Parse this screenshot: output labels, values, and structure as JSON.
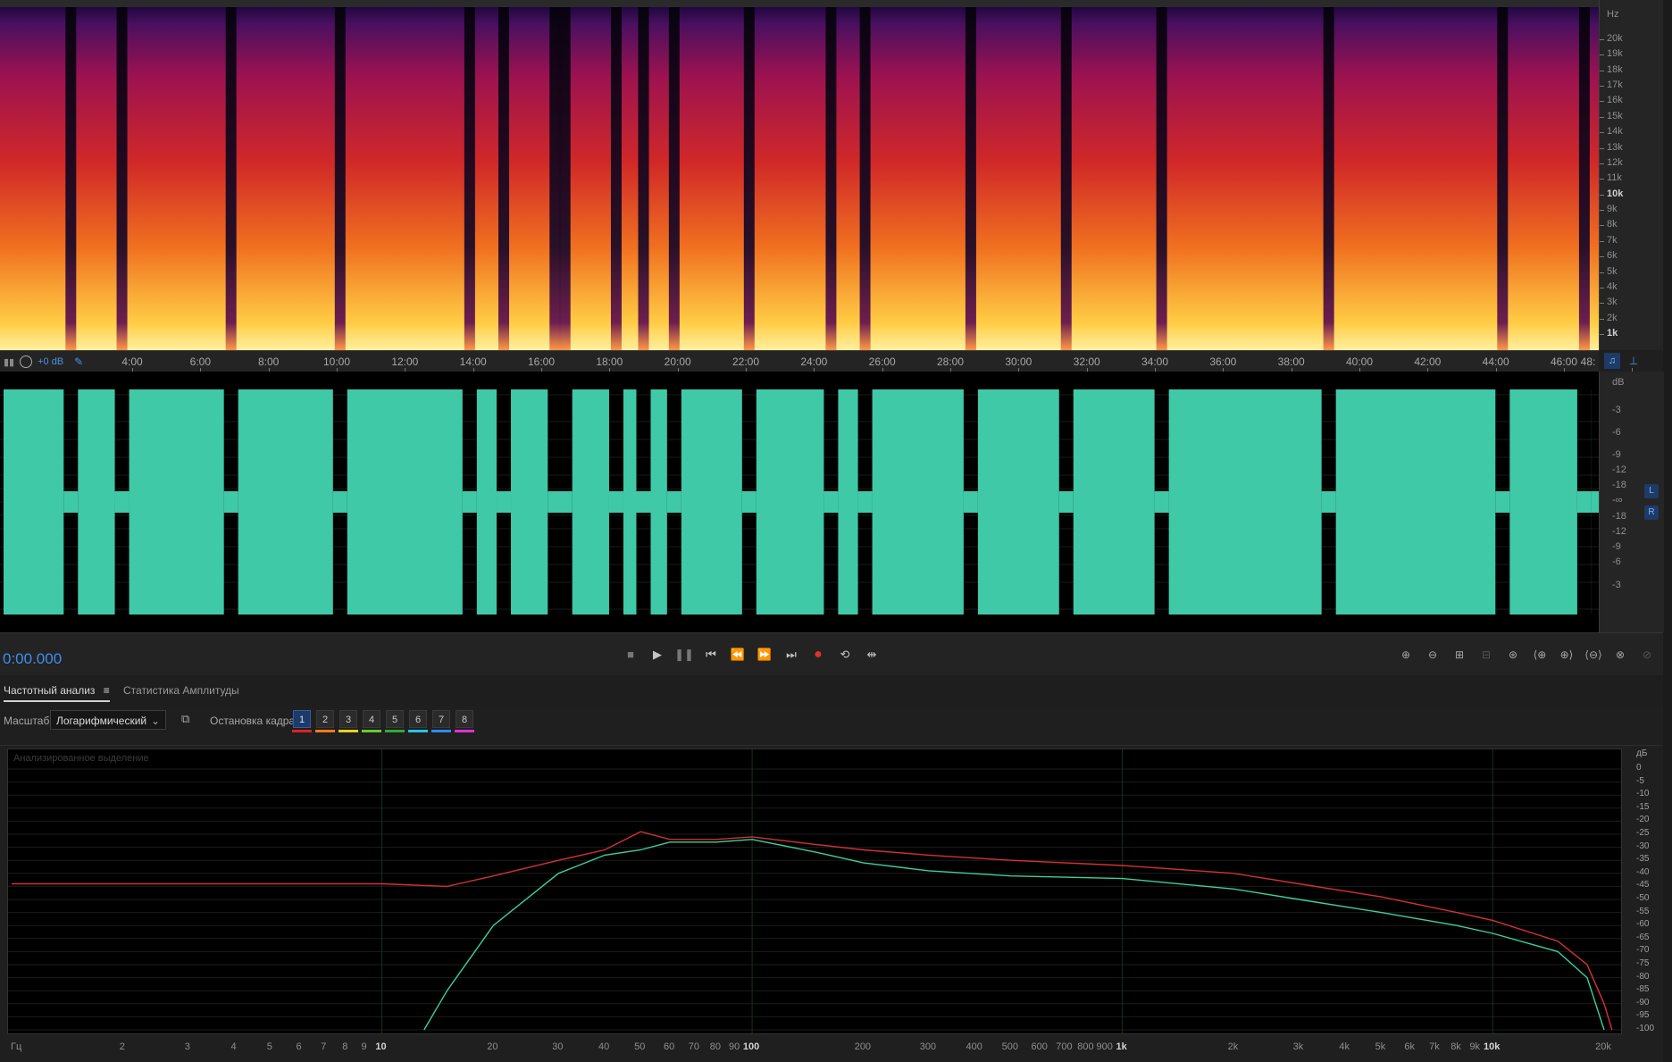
{
  "spectrogram": {
    "unit": "Hz",
    "freq_labels": [
      {
        "text": "20k",
        "v": 20
      },
      {
        "text": "19k",
        "v": 19
      },
      {
        "text": "18k",
        "v": 18
      },
      {
        "text": "17k",
        "v": 17
      },
      {
        "text": "16k",
        "v": 16
      },
      {
        "text": "15k",
        "v": 15
      },
      {
        "text": "14k",
        "v": 14
      },
      {
        "text": "13k",
        "v": 13
      },
      {
        "text": "12k",
        "v": 12
      },
      {
        "text": "11k",
        "v": 11
      },
      {
        "text": "10k",
        "v": 10,
        "bold": true
      },
      {
        "text": "9k",
        "v": 9
      },
      {
        "text": "8k",
        "v": 8
      },
      {
        "text": "7k",
        "v": 7
      },
      {
        "text": "6k",
        "v": 6
      },
      {
        "text": "5k",
        "v": 5
      },
      {
        "text": "4k",
        "v": 4
      },
      {
        "text": "3k",
        "v": 3
      },
      {
        "text": "2k",
        "v": 2
      },
      {
        "text": "1k",
        "v": 1,
        "bold": true
      }
    ],
    "gap_times": [
      2.2,
      3.7,
      6.9,
      10.1,
      13.9,
      14.9,
      16.4,
      16.7,
      18.2,
      19.0,
      19.9,
      22.1,
      24.5,
      25.5,
      28.6,
      31.4,
      34.2,
      39.1,
      44.2,
      46.6
    ]
  },
  "time_ruler": {
    "gain": "+0 dB",
    "labels": [
      "4:00",
      "6:00",
      "8:00",
      "10:00",
      "12:00",
      "14:00",
      "16:00",
      "18:00",
      "20:00",
      "22:00",
      "24:00",
      "26:00",
      "28:00",
      "30:00",
      "32:00",
      "34:00",
      "36:00",
      "38:00",
      "40:00",
      "42:00",
      "44:00",
      "46:00",
      "48:"
    ],
    "label_minutes": [
      4,
      6,
      8,
      10,
      12,
      14,
      16,
      18,
      20,
      22,
      24,
      26,
      28,
      30,
      32,
      34,
      36,
      38,
      40,
      42,
      44,
      46,
      48
    ]
  },
  "waveform": {
    "unit": "dB",
    "db_labels_top": [
      "-3",
      "-6",
      "-9",
      "-12",
      "-18",
      "-∞"
    ],
    "db_labels_bottom": [
      "-18",
      "-12",
      "-9",
      "-6",
      "-3"
    ],
    "channel_left": "L",
    "channel_right": "R",
    "color": "#3fc9a7"
  },
  "transport": {
    "time": "0:00.000"
  },
  "tabs": {
    "frequency_analysis": "Частотный анализ",
    "amplitude_stats": "Статистика Амплитуды"
  },
  "controls": {
    "scale_label": "Масштаб:",
    "scale_value": "Логарифмический",
    "freeze_label": "Остановка кадра:",
    "frames": [
      {
        "n": "1",
        "color": "#e02020"
      },
      {
        "n": "2",
        "color": "#f07a1a"
      },
      {
        "n": "3",
        "color": "#e8d020"
      },
      {
        "n": "4",
        "color": "#66cc33"
      },
      {
        "n": "5",
        "color": "#33aa33"
      },
      {
        "n": "6",
        "color": "#22c8e0"
      },
      {
        "n": "7",
        "color": "#2a8cf0"
      },
      {
        "n": "8",
        "color": "#e030d0"
      }
    ]
  },
  "freq_analysis": {
    "analyzed_label": "Анализированное выделение",
    "db_unit": "дБ",
    "db_labels": [
      "0",
      "-5",
      "-10",
      "-15",
      "-20",
      "-25",
      "-30",
      "-35",
      "-40",
      "-45",
      "-50",
      "-55",
      "-60",
      "-65",
      "-70",
      "-75",
      "-80",
      "-85",
      "-90",
      "-95",
      "-100"
    ],
    "x_unit": "Гц",
    "x_labels": [
      {
        "text": "2",
        "f": 2
      },
      {
        "text": "3",
        "f": 3
      },
      {
        "text": "4",
        "f": 4
      },
      {
        "text": "5",
        "f": 5
      },
      {
        "text": "6",
        "f": 6
      },
      {
        "text": "7",
        "f": 7
      },
      {
        "text": "8",
        "f": 8
      },
      {
        "text": "9",
        "f": 9
      },
      {
        "text": "10",
        "f": 10,
        "bold": true
      },
      {
        "text": "20",
        "f": 20
      },
      {
        "text": "30",
        "f": 30
      },
      {
        "text": "40",
        "f": 40
      },
      {
        "text": "50",
        "f": 50
      },
      {
        "text": "60",
        "f": 60
      },
      {
        "text": "70",
        "f": 70
      },
      {
        "text": "80",
        "f": 80
      },
      {
        "text": "90",
        "f": 90
      },
      {
        "text": "100",
        "f": 100,
        "bold": true
      },
      {
        "text": "200",
        "f": 200
      },
      {
        "text": "300",
        "f": 300
      },
      {
        "text": "400",
        "f": 400
      },
      {
        "text": "500",
        "f": 500
      },
      {
        "text": "600",
        "f": 600
      },
      {
        "text": "700",
        "f": 700
      },
      {
        "text": "800",
        "f": 800
      },
      {
        "text": "900",
        "f": 900
      },
      {
        "text": "1k",
        "f": 1000,
        "bold": true
      },
      {
        "text": "2k",
        "f": 2000
      },
      {
        "text": "3k",
        "f": 3000
      },
      {
        "text": "4k",
        "f": 4000
      },
      {
        "text": "5k",
        "f": 5000
      },
      {
        "text": "6k",
        "f": 6000
      },
      {
        "text": "7k",
        "f": 7000
      },
      {
        "text": "8k",
        "f": 8000
      },
      {
        "text": "9k",
        "f": 9000
      },
      {
        "text": "10k",
        "f": 10000,
        "bold": true
      },
      {
        "text": "20k",
        "f": 20000
      }
    ],
    "series": [
      {
        "color": "#d43232",
        "points": [
          [
            1,
            -44
          ],
          [
            10,
            -44
          ],
          [
            15,
            -45
          ],
          [
            20,
            -41
          ],
          [
            30,
            -35
          ],
          [
            40,
            -31
          ],
          [
            50,
            -24
          ],
          [
            60,
            -27
          ],
          [
            80,
            -27
          ],
          [
            100,
            -26
          ],
          [
            150,
            -29
          ],
          [
            200,
            -31
          ],
          [
            300,
            -33
          ],
          [
            500,
            -35
          ],
          [
            1000,
            -37
          ],
          [
            2000,
            -40
          ],
          [
            3000,
            -44
          ],
          [
            5000,
            -49
          ],
          [
            8000,
            -55
          ],
          [
            10000,
            -58
          ],
          [
            15000,
            -66
          ],
          [
            18000,
            -75
          ],
          [
            20000,
            -90
          ],
          [
            21000,
            -100
          ]
        ]
      },
      {
        "color": "#3fcf9a",
        "points": [
          [
            13,
            -100
          ],
          [
            15,
            -85
          ],
          [
            20,
            -60
          ],
          [
            30,
            -40
          ],
          [
            40,
            -33
          ],
          [
            50,
            -31
          ],
          [
            60,
            -28
          ],
          [
            80,
            -28
          ],
          [
            100,
            -27
          ],
          [
            150,
            -32
          ],
          [
            200,
            -36
          ],
          [
            300,
            -39
          ],
          [
            500,
            -41
          ],
          [
            1000,
            -42
          ],
          [
            2000,
            -46
          ],
          [
            3000,
            -50
          ],
          [
            5000,
            -55
          ],
          [
            8000,
            -60
          ],
          [
            10000,
            -63
          ],
          [
            15000,
            -70
          ],
          [
            18000,
            -80
          ],
          [
            20000,
            -100
          ]
        ]
      }
    ]
  }
}
